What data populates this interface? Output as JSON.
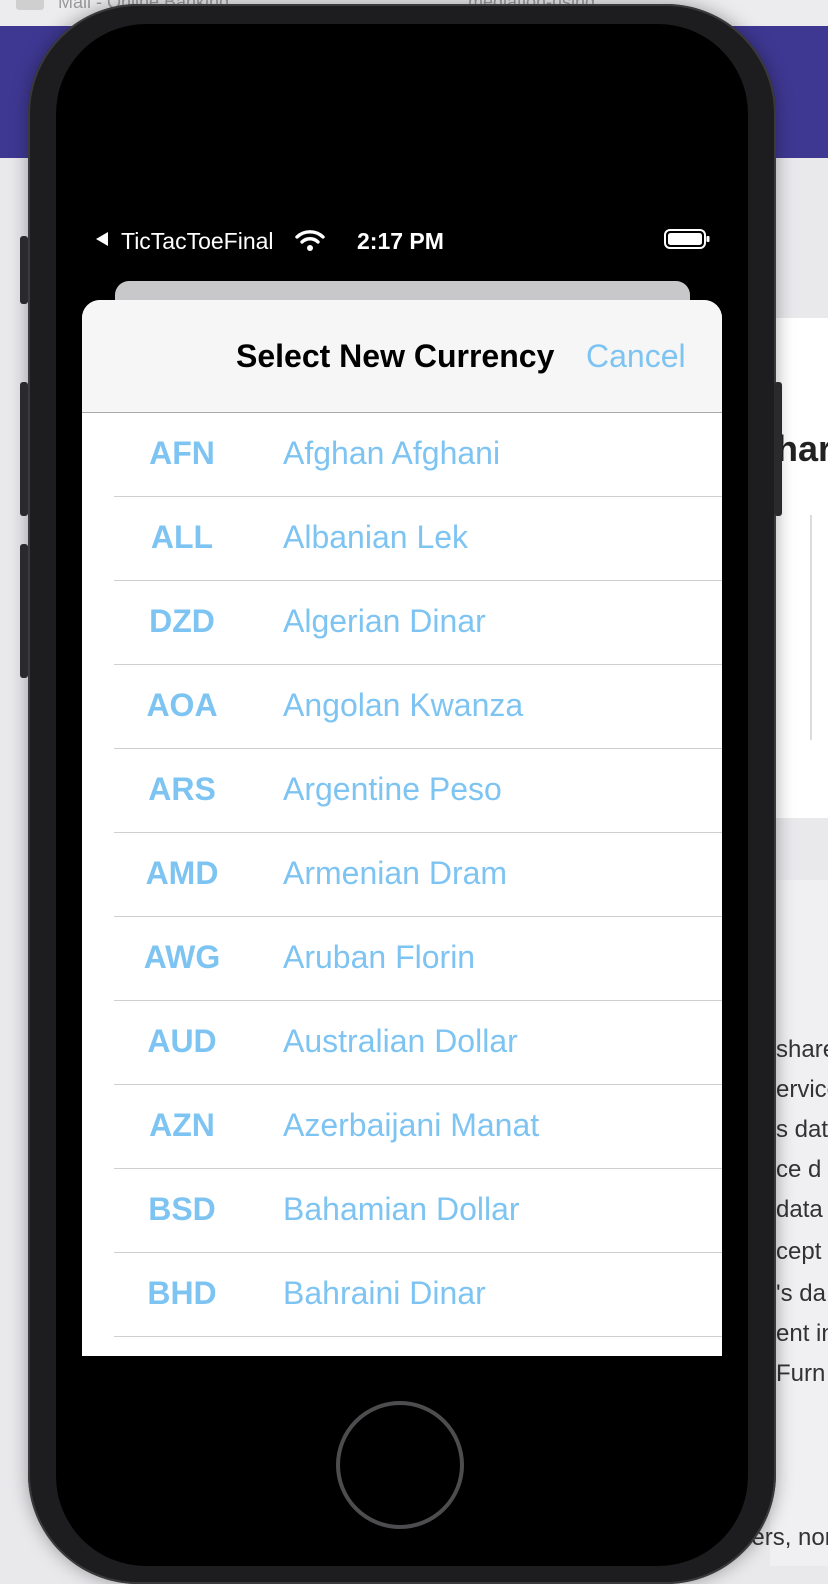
{
  "host": {
    "topbar_left": "Mail - Online Banking",
    "topbar_right": "mediation-using",
    "heading_fragment": "har",
    "text_lines": [
      "share",
      "ervice",
      "s data",
      "ce d",
      "data",
      "cept",
      "'s da",
      "ent in",
      "Furn",
      "pers, nor"
    ]
  },
  "status_bar": {
    "back_app": "TicTacToeFinal",
    "time": "2:17 PM"
  },
  "sheet": {
    "title": "Select New Currency",
    "cancel_label": "Cancel"
  },
  "currencies": [
    {
      "code": "AFN",
      "name": "Afghan Afghani"
    },
    {
      "code": "ALL",
      "name": "Albanian Lek"
    },
    {
      "code": "DZD",
      "name": "Algerian Dinar"
    },
    {
      "code": "AOA",
      "name": "Angolan Kwanza"
    },
    {
      "code": "ARS",
      "name": "Argentine Peso"
    },
    {
      "code": "AMD",
      "name": "Armenian Dram"
    },
    {
      "code": "AWG",
      "name": "Aruban Florin"
    },
    {
      "code": "AUD",
      "name": "Australian Dollar"
    },
    {
      "code": "AZN",
      "name": "Azerbaijani Manat"
    },
    {
      "code": "BSD",
      "name": "Bahamian Dollar"
    },
    {
      "code": "BHD",
      "name": "Bahraini Dinar"
    }
  ],
  "colors": {
    "accent": "#7ec4f2",
    "host_header": "#3f3893"
  }
}
